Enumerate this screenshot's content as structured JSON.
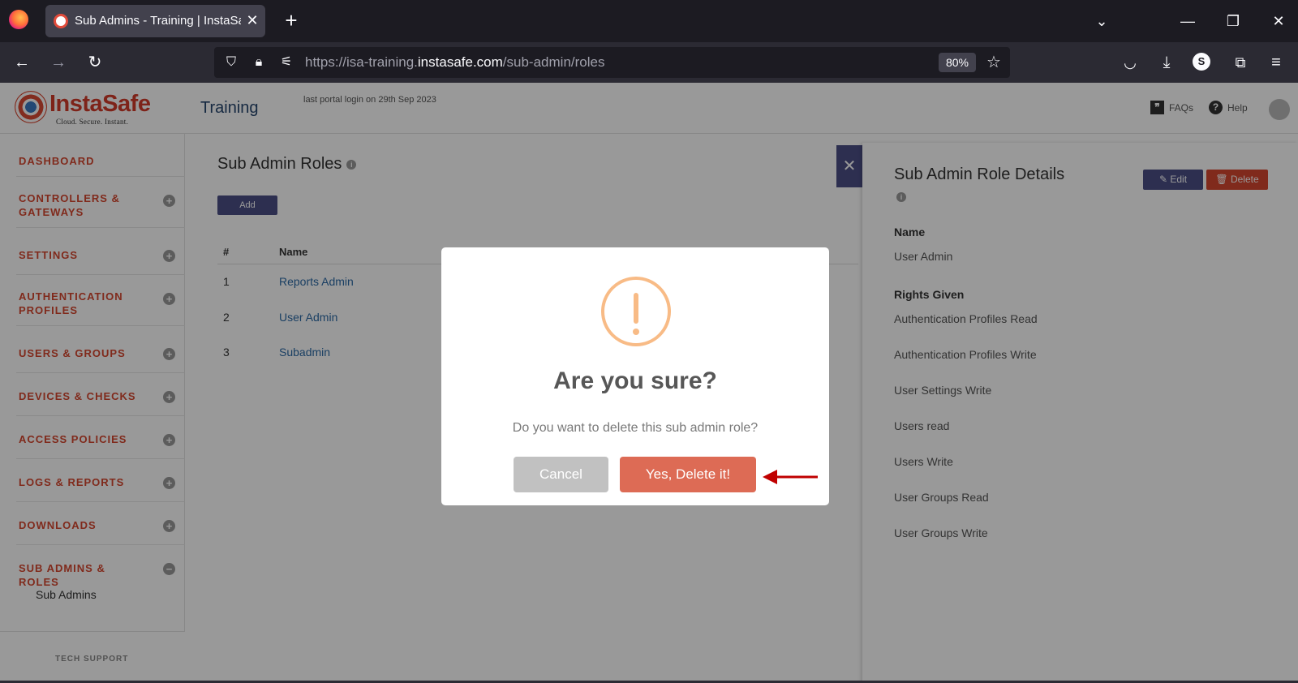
{
  "browser": {
    "tab_title": "Sub Admins - Training | InstaSafe",
    "url_prefix": "https://isa-training.",
    "url_domain": "instasafe.com",
    "url_path": "/sub-admin/roles",
    "zoom": "80%",
    "profile_initial": "S"
  },
  "header": {
    "logo_name": "InstaSafe",
    "logo_tagline": "Cloud. Secure. Instant.",
    "portal_name": "Training",
    "last_login": "last portal login on 29th Sep 2023",
    "faqs_label": "FAQs",
    "help_label": "Help"
  },
  "sidebar": {
    "items": [
      {
        "label": "DASHBOARD"
      },
      {
        "label": "CONTROLLERS & GATEWAYS"
      },
      {
        "label": "SETTINGS"
      },
      {
        "label": "AUTHENTICATION PROFILES"
      },
      {
        "label": "USERS & GROUPS"
      },
      {
        "label": "DEVICES & CHECKS"
      },
      {
        "label": "ACCESS POLICIES"
      },
      {
        "label": "LOGS & REPORTS"
      },
      {
        "label": "DOWNLOADS"
      },
      {
        "label": "SUB ADMINS & ROLES"
      }
    ],
    "sub_item": "Sub Admins",
    "tech_support": "TECH SUPPORT"
  },
  "main": {
    "title": "Sub Admin Roles",
    "add_label": "Add",
    "col_num": "#",
    "col_name": "Name",
    "rows": [
      {
        "num": "1",
        "name": "Reports Admin"
      },
      {
        "num": "2",
        "name": "User Admin"
      },
      {
        "num": "3",
        "name": "Subadmin"
      }
    ]
  },
  "panel": {
    "title": "Sub Admin Role Details",
    "edit_label": "Edit",
    "delete_label": "Delete",
    "name_label": "Name",
    "name_value": "User Admin",
    "rights_label": "Rights Given",
    "rights": [
      "Authentication Profiles Read",
      "Authentication Profiles Write",
      "User Settings Write",
      "Users read",
      "Users Write",
      "User Groups Read",
      "User Groups Write"
    ]
  },
  "modal": {
    "title": "Are you sure?",
    "text": "Do you want to delete this sub admin role?",
    "cancel_label": "Cancel",
    "confirm_label": "Yes, Delete it!"
  },
  "colors": {
    "accent": "#4c4f86",
    "danger": "#d6472f",
    "confirm": "#dd6b55",
    "warning": "#f8bb86",
    "annotation_arrow": "#c00000"
  }
}
